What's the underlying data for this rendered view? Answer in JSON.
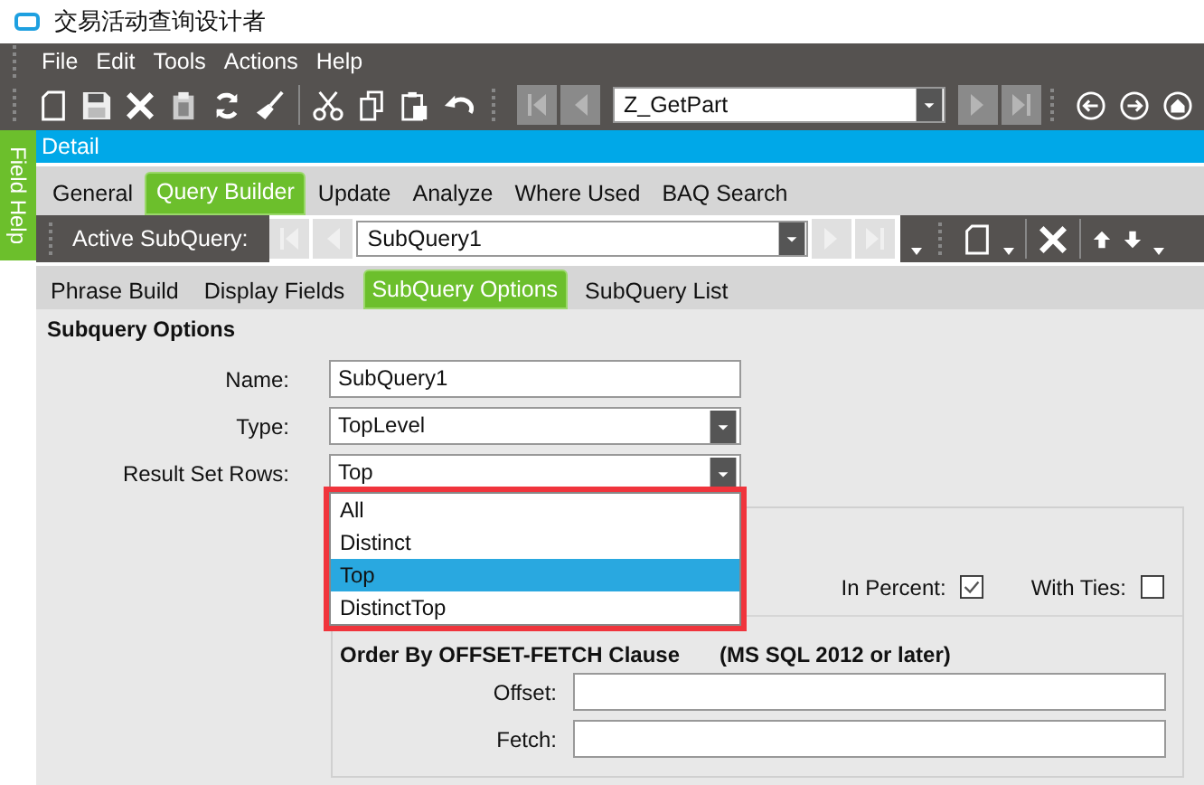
{
  "window": {
    "title": "交易活动查询设计者"
  },
  "menu": [
    "File",
    "Edit",
    "Tools",
    "Actions",
    "Help"
  ],
  "toolbar": {
    "query_value": "Z_GetPart"
  },
  "side_tab": "Field Help",
  "panel_title": "Detail",
  "tabs": [
    {
      "label": "General",
      "selected": false
    },
    {
      "label": "Query Builder",
      "selected": true
    },
    {
      "label": "Update",
      "selected": false
    },
    {
      "label": "Analyze",
      "selected": false
    },
    {
      "label": "Where Used",
      "selected": false
    },
    {
      "label": "BAQ Search",
      "selected": false
    }
  ],
  "subquery_bar": {
    "label": "Active SubQuery:",
    "value": "SubQuery1"
  },
  "subtabs": [
    {
      "label": "Phrase Build",
      "selected": false
    },
    {
      "label": "Display Fields",
      "selected": false
    },
    {
      "label": "SubQuery Options",
      "selected": true
    },
    {
      "label": "SubQuery List",
      "selected": false
    }
  ],
  "section_title": "Subquery Options",
  "fields": [
    {
      "label": "Name:",
      "value": "SubQuery1",
      "kind": "text"
    },
    {
      "label": "Type:",
      "value": "TopLevel",
      "kind": "select"
    },
    {
      "label": "Result Set Rows:",
      "value": "Top",
      "kind": "select"
    }
  ],
  "dropdown": {
    "options": [
      {
        "label": "All",
        "selected": false
      },
      {
        "label": "Distinct",
        "selected": false
      },
      {
        "label": "Top",
        "selected": true
      },
      {
        "label": "DistinctTop",
        "selected": false
      }
    ]
  },
  "checks": [
    {
      "label": "In Percent:",
      "checked": true
    },
    {
      "label": "With Ties:",
      "checked": false
    }
  ],
  "order_by": {
    "title": "Order By OFFSET-FETCH Clause",
    "note": "(MS SQL 2012 or later)",
    "fields": [
      "Offset:",
      "Fetch:"
    ]
  }
}
